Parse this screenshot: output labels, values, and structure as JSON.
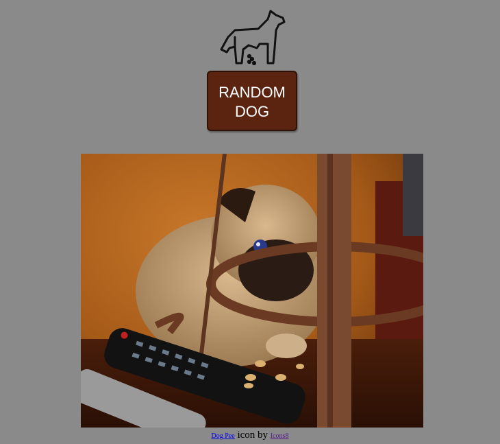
{
  "header": {
    "logo_icon": "dog-pee-icon"
  },
  "button": {
    "label": "RANDOM\nDOG"
  },
  "image": {
    "subject": "pug-photo"
  },
  "credit": {
    "icon_link": "Dog Pee",
    "middle_text": " icon by ",
    "author_link": "Icons8"
  },
  "colors": {
    "background": "#8a8a8a",
    "button_bg": "#5a2410",
    "button_text": "#ffffff"
  }
}
